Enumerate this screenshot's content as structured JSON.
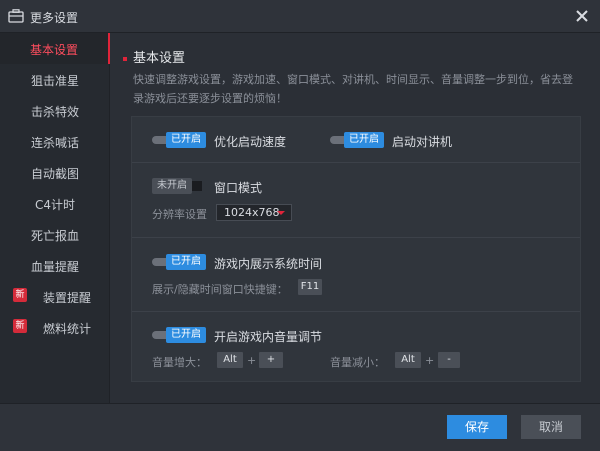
{
  "window": {
    "title": "更多设置"
  },
  "sidebar": {
    "items": [
      {
        "label": "基本设置",
        "active": true
      },
      {
        "label": "狙击准星"
      },
      {
        "label": "击杀特效"
      },
      {
        "label": "连杀喊话"
      },
      {
        "label": "自动截图"
      },
      {
        "label": "C4计时"
      },
      {
        "label": "死亡报血"
      },
      {
        "label": "血量提醒"
      },
      {
        "label": "装置提醒",
        "badge": "新"
      },
      {
        "label": "燃料统计",
        "badge": "新"
      }
    ]
  },
  "main": {
    "title": "基本设置",
    "description": "快速调整游戏设置，游戏加速、窗口模式、对讲机、时间显示、音量调整一步到位，省去登录游戏后还要逐步设置的烦恼！",
    "options": {
      "startup_speed": {
        "state": "已开启",
        "label": "优化启动速度"
      },
      "walkie_talkie": {
        "state": "已开启",
        "label": "启动对讲机"
      },
      "window_mode": {
        "state": "未开启",
        "label": "窗口模式",
        "resolution_label": "分辨率设置",
        "resolution_value": "1024x768"
      },
      "system_time": {
        "state": "已开启",
        "label": "游戏内展示系统时间",
        "hotkey_label": "展示/隐藏时间窗口快捷键：",
        "hotkey": "F11"
      },
      "volume": {
        "state": "已开启",
        "label": "开启游戏内音量调节",
        "up_label": "音量增大：",
        "up_key1": "Alt",
        "up_key2": "+",
        "down_label": "音量减小：",
        "down_key1": "Alt",
        "down_key2": "-",
        "plus": "+"
      }
    }
  },
  "footer": {
    "save": "保存",
    "cancel": "取消"
  },
  "colors": {
    "accent": "#2d8ce0",
    "highlight": "#e0243a",
    "background": "#2b2f36"
  },
  "icons": {
    "app": "briefcase-icon",
    "close": "close-icon"
  }
}
